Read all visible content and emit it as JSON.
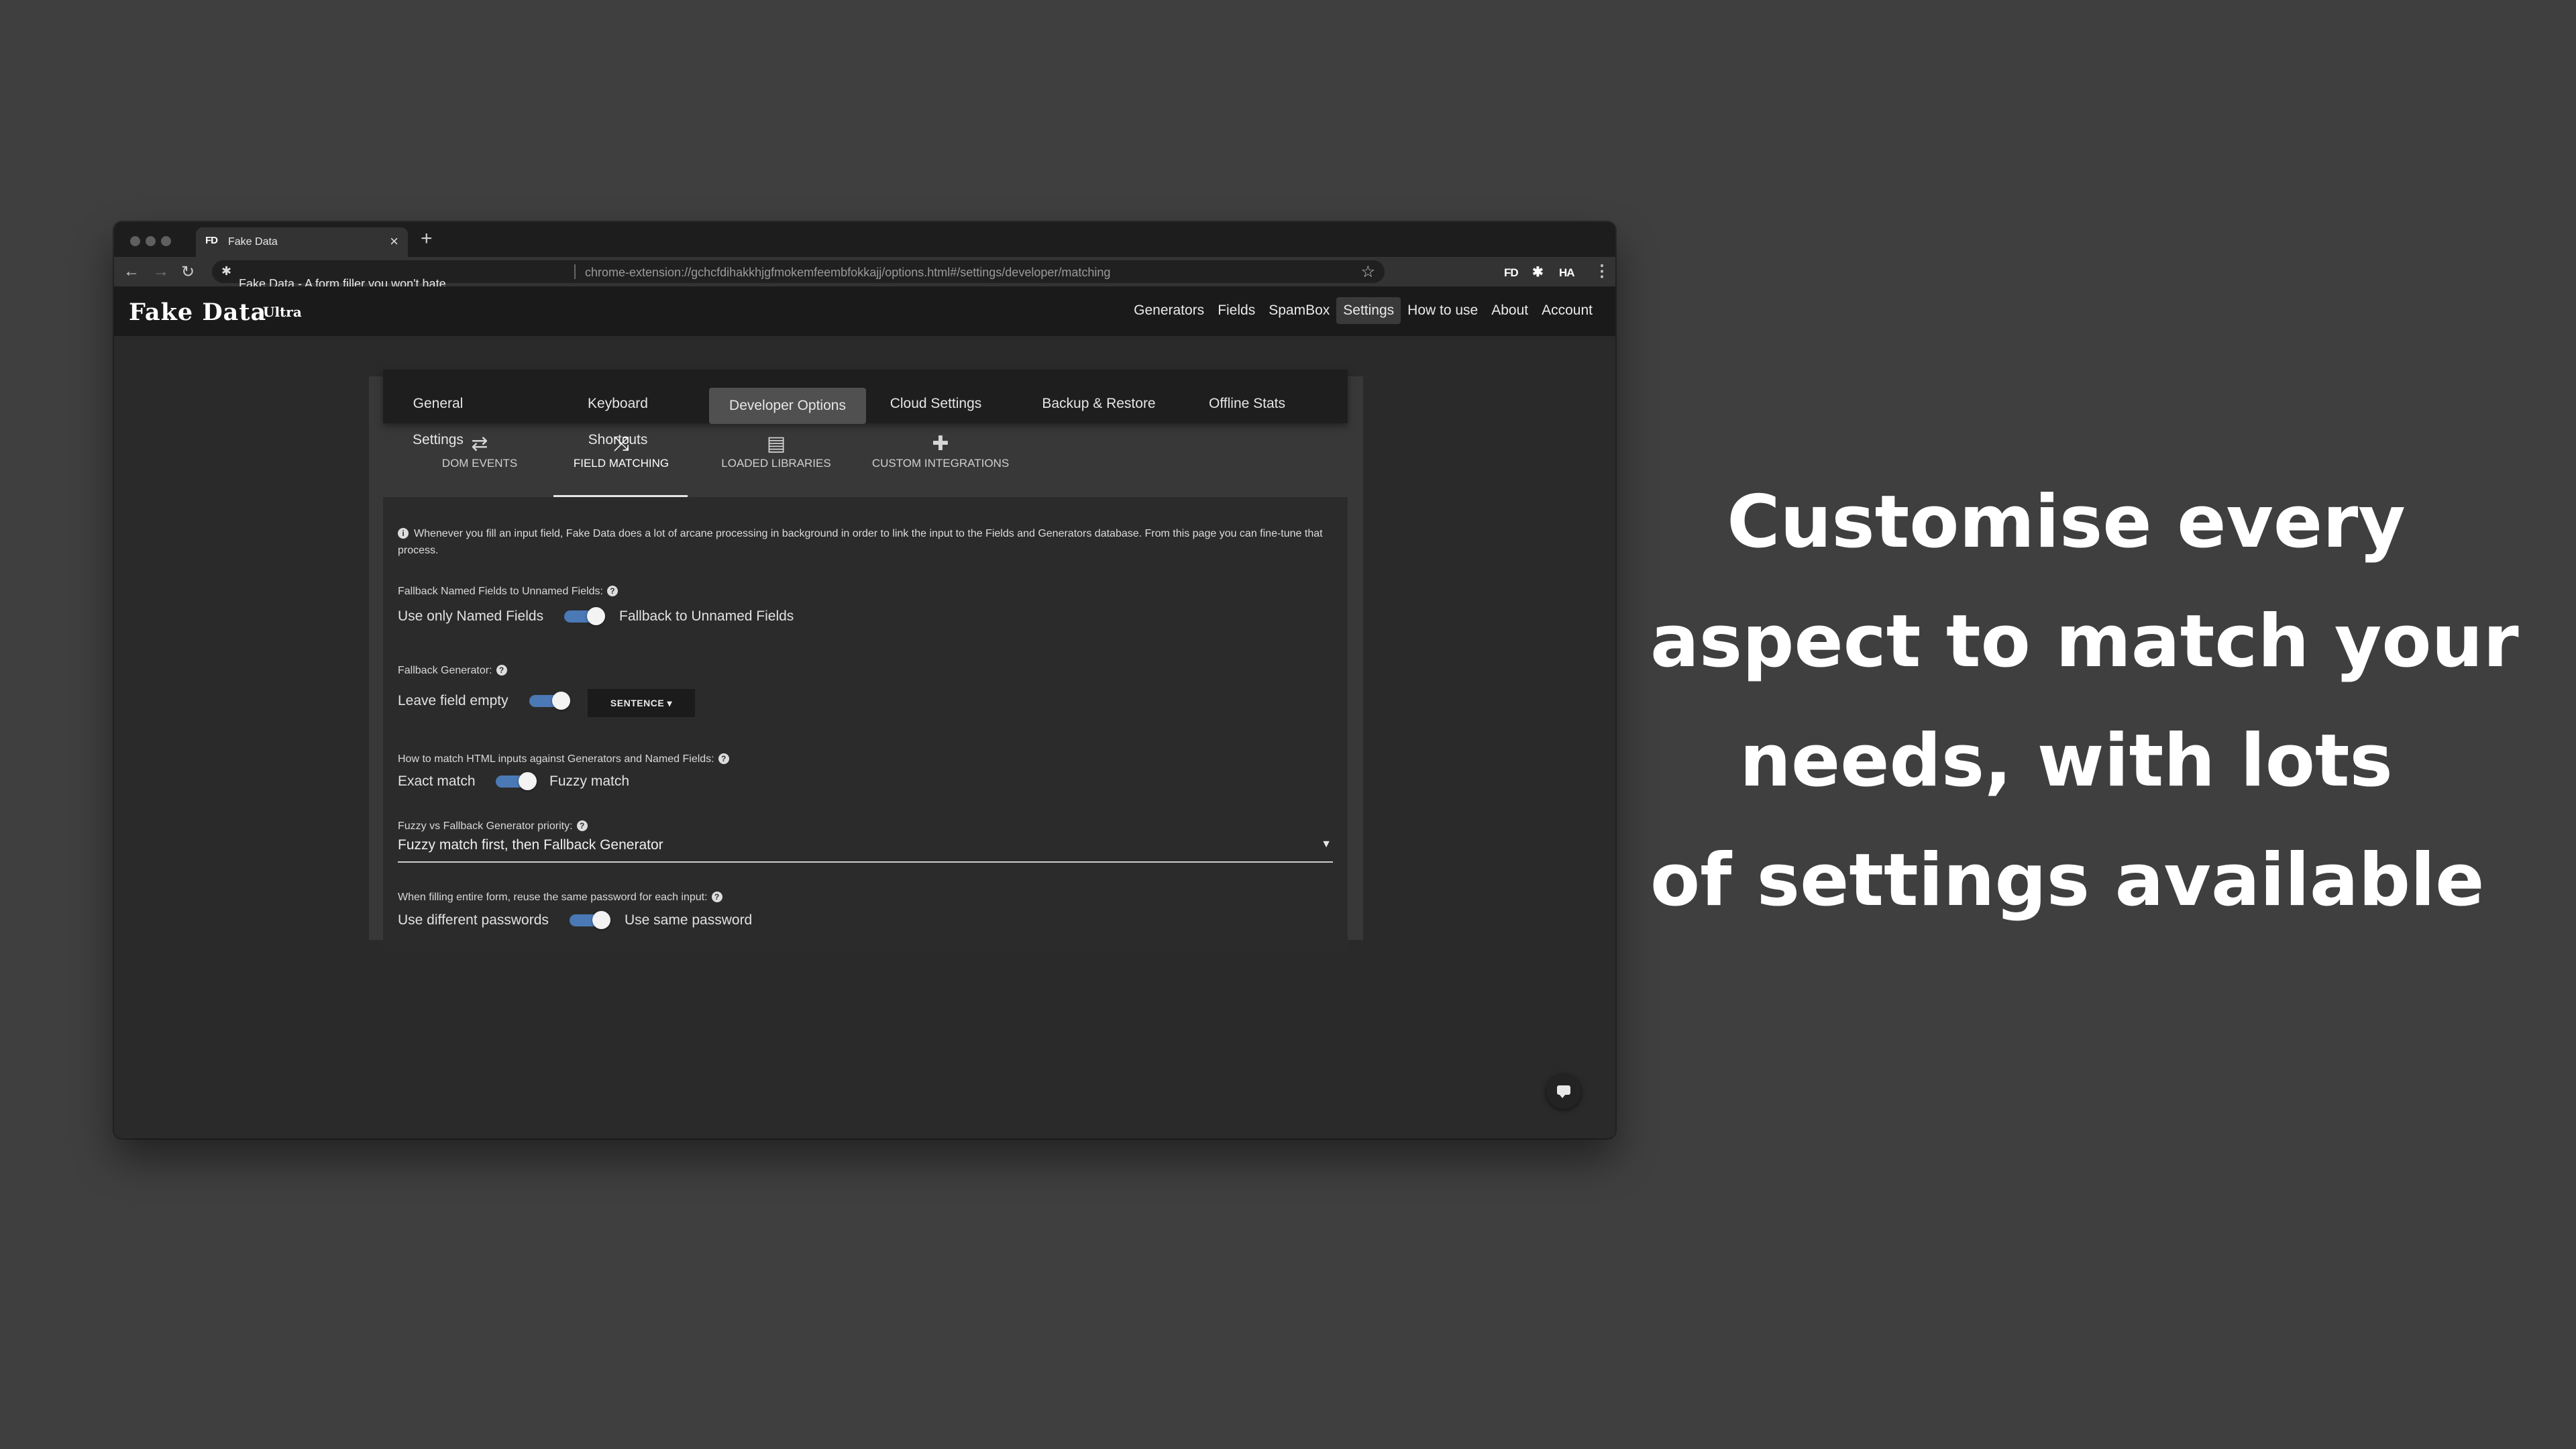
{
  "browser": {
    "tab_title": "Fake Data",
    "tab_favicon": "FD",
    "tab_close": "×",
    "new_tab": "+",
    "page_title": "Fake Data - A form filler you won't hate",
    "url": "chrome-extension://gchcfdihakkhjgfmokemfeembfokkajj/options.html#/settings/developer/matching",
    "ext_fd": "FD",
    "ext_puzzle": "✱",
    "ext_avatar": "HA",
    "icons": {
      "back": "←",
      "forward": "→",
      "reload": "↻",
      "star": "☆",
      "menu": "⋮"
    }
  },
  "app": {
    "logo": "Fake Data",
    "logo_suffix": "Ultra",
    "menu": [
      "Generators",
      "Fields",
      "SpamBox",
      "Settings",
      "How to use",
      "About",
      "Account"
    ],
    "active_menu": "Settings"
  },
  "settings_tabs": [
    "General Settings",
    "Keyboard Shortcuts",
    "Developer Options",
    "Cloud Settings",
    "Backup & Restore",
    "Offline Stats"
  ],
  "active_settings_tab": "Developer Options",
  "developer_tabs": [
    "DOM EVENTS",
    "FIELD MATCHING",
    "LOADED LIBRARIES",
    "CUSTOM INTEGRATIONS"
  ],
  "active_developer_tab": "FIELD MATCHING",
  "panel": {
    "info": "Whenever you fill an input field, Fake Data does a lot of arcane processing in background in order to link the input to the Fields and Generators database. From this page you can fine-tune that process.",
    "fallback_named": {
      "label": "Fallback Named Fields to Unnamed Fields:",
      "off_label": "Use only Named Fields",
      "on_label": "Fallback to Unnamed Fields",
      "enabled": true
    },
    "fallback_generator": {
      "label": "Fallback Generator:",
      "off_label": "Leave field empty",
      "enabled": true,
      "dropdown": "SENTENCE ▾"
    },
    "match_mode": {
      "label": "How to match HTML inputs against Generators and Named Fields:",
      "off_label": "Exact match",
      "on_label": "Fuzzy match",
      "enabled": true
    },
    "priority": {
      "label": "Fuzzy vs Fallback Generator priority:",
      "value": "Fuzzy match first, then Fallback Generator",
      "arrow": "▼"
    },
    "password": {
      "label": "When filling entire form, reuse the same password for each input:",
      "off_label": "Use different passwords",
      "on_label": "Use same password",
      "enabled": true
    }
  },
  "headline": [
    "Customise every",
    "aspect to match your",
    "needs, with lots",
    "of settings available"
  ],
  "colors": {
    "background": "#3f3f3f",
    "toggle_on": "#4a79b5",
    "panel": "#2b2b2b"
  }
}
